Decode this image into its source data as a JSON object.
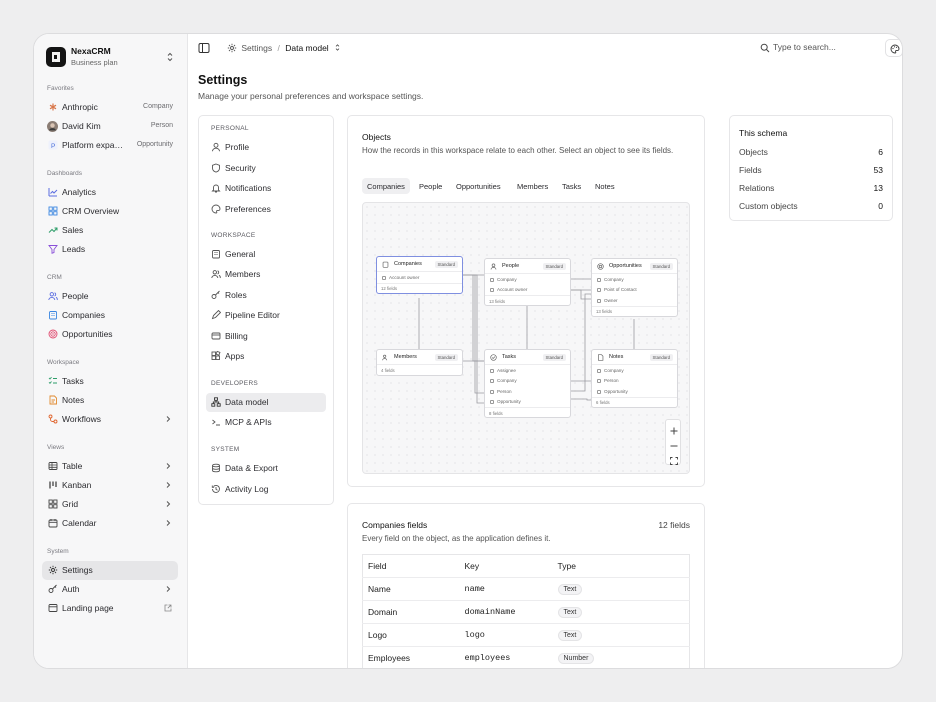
{
  "workspace": {
    "name": "NexaCRM",
    "plan": "Business plan"
  },
  "sidebar": {
    "favorites_label": "Favorites",
    "favorites": [
      {
        "label": "Anthropic",
        "meta": "Company"
      },
      {
        "label": "David Kim",
        "meta": "Person"
      },
      {
        "label": "Platform expa…",
        "meta": "Opportunity"
      }
    ],
    "dashboards_label": "Dashboards",
    "dashboards": [
      "Analytics",
      "CRM Overview",
      "Sales",
      "Leads"
    ],
    "crm_label": "CRM",
    "crm": [
      "People",
      "Companies",
      "Opportunities"
    ],
    "workspace_label": "Workspace",
    "workspace_items": [
      "Tasks",
      "Notes",
      "Workflows"
    ],
    "views_label": "Views",
    "views": [
      "Table",
      "Kanban",
      "Grid",
      "Calendar"
    ],
    "system_label": "System",
    "system": [
      "Settings",
      "Auth",
      "Landing page"
    ]
  },
  "topbar": {
    "crumb_parent": "Settings",
    "crumb_sep": "/",
    "crumb_current": "Data model",
    "search_placeholder": "Type to search..."
  },
  "page": {
    "title": "Settings",
    "subtitle": "Manage your personal preferences and workspace settings."
  },
  "settings_nav": {
    "personal_label": "PERSONAL",
    "personal": [
      "Profile",
      "Security",
      "Notifications",
      "Preferences"
    ],
    "workspace_label": "WORKSPACE",
    "workspace": [
      "General",
      "Members",
      "Roles",
      "Pipeline Editor",
      "Billing",
      "Apps"
    ],
    "developers_label": "DEVELOPERS",
    "developers": [
      "Data model",
      "MCP & APIs"
    ],
    "system_label": "SYSTEM",
    "system": [
      "Data & Export",
      "Activity Log"
    ]
  },
  "objects": {
    "title": "Objects",
    "description": "How the records in this workspace relate to each other. Select an object to see its fields.",
    "tabs": [
      "Companies",
      "People",
      "Opportunities",
      "Members",
      "Tasks",
      "Notes"
    ],
    "nodes": {
      "companies": {
        "title": "Companies",
        "badge": "Standard",
        "fields": [
          "Account owner"
        ],
        "footer": "12 fields"
      },
      "people": {
        "title": "People",
        "badge": "Standard",
        "fields": [
          "Company",
          "Account owner"
        ],
        "footer": "13 fields"
      },
      "opportunities": {
        "title": "Opportunities",
        "badge": "Standard",
        "fields": [
          "Company",
          "Point of Contact",
          "Owner"
        ],
        "footer": "13 fields"
      },
      "members": {
        "title": "Members",
        "badge": "Standard",
        "fields": [],
        "footer": "4 fields"
      },
      "tasks": {
        "title": "Tasks",
        "badge": "Standard",
        "fields": [
          "Assignee",
          "Company",
          "Person",
          "Opportunity"
        ],
        "footer": "8 fields"
      },
      "notes": {
        "title": "Notes",
        "badge": "Standard",
        "fields": [
          "Company",
          "Person",
          "Opportunity"
        ],
        "footer": "6 fields"
      }
    }
  },
  "fields_card": {
    "title": "Companies fields",
    "count": "12 fields",
    "description": "Every field on the object, as the application defines it.",
    "headers": [
      "Field",
      "Key",
      "Type"
    ],
    "rows": [
      {
        "field": "Name",
        "key": "name",
        "type": "Text"
      },
      {
        "field": "Domain",
        "key": "domainName",
        "type": "Text"
      },
      {
        "field": "Logo",
        "key": "logo",
        "type": "Text"
      },
      {
        "field": "Employees",
        "key": "employees",
        "type": "Number"
      }
    ]
  },
  "schema": {
    "title": "This schema",
    "stats": [
      {
        "label": "Objects",
        "value": "6"
      },
      {
        "label": "Fields",
        "value": "53"
      },
      {
        "label": "Relations",
        "value": "13"
      },
      {
        "label": "Custom objects",
        "value": "0"
      }
    ]
  },
  "icons": {
    "accent_anthropic": "#d9774a",
    "accent_platform": "#4a6fd9",
    "color_analytics": "#5b6ee1",
    "color_sales": "#2e9e6a",
    "color_leads": "#8a4fd9",
    "color_people": "#5b6ee1",
    "color_companies": "#3a86e0",
    "color_opportunities": "#e04a6f",
    "color_tasks": "#2e9e6a",
    "color_notes": "#e08a2e",
    "color_workflows": "#e0652e"
  }
}
